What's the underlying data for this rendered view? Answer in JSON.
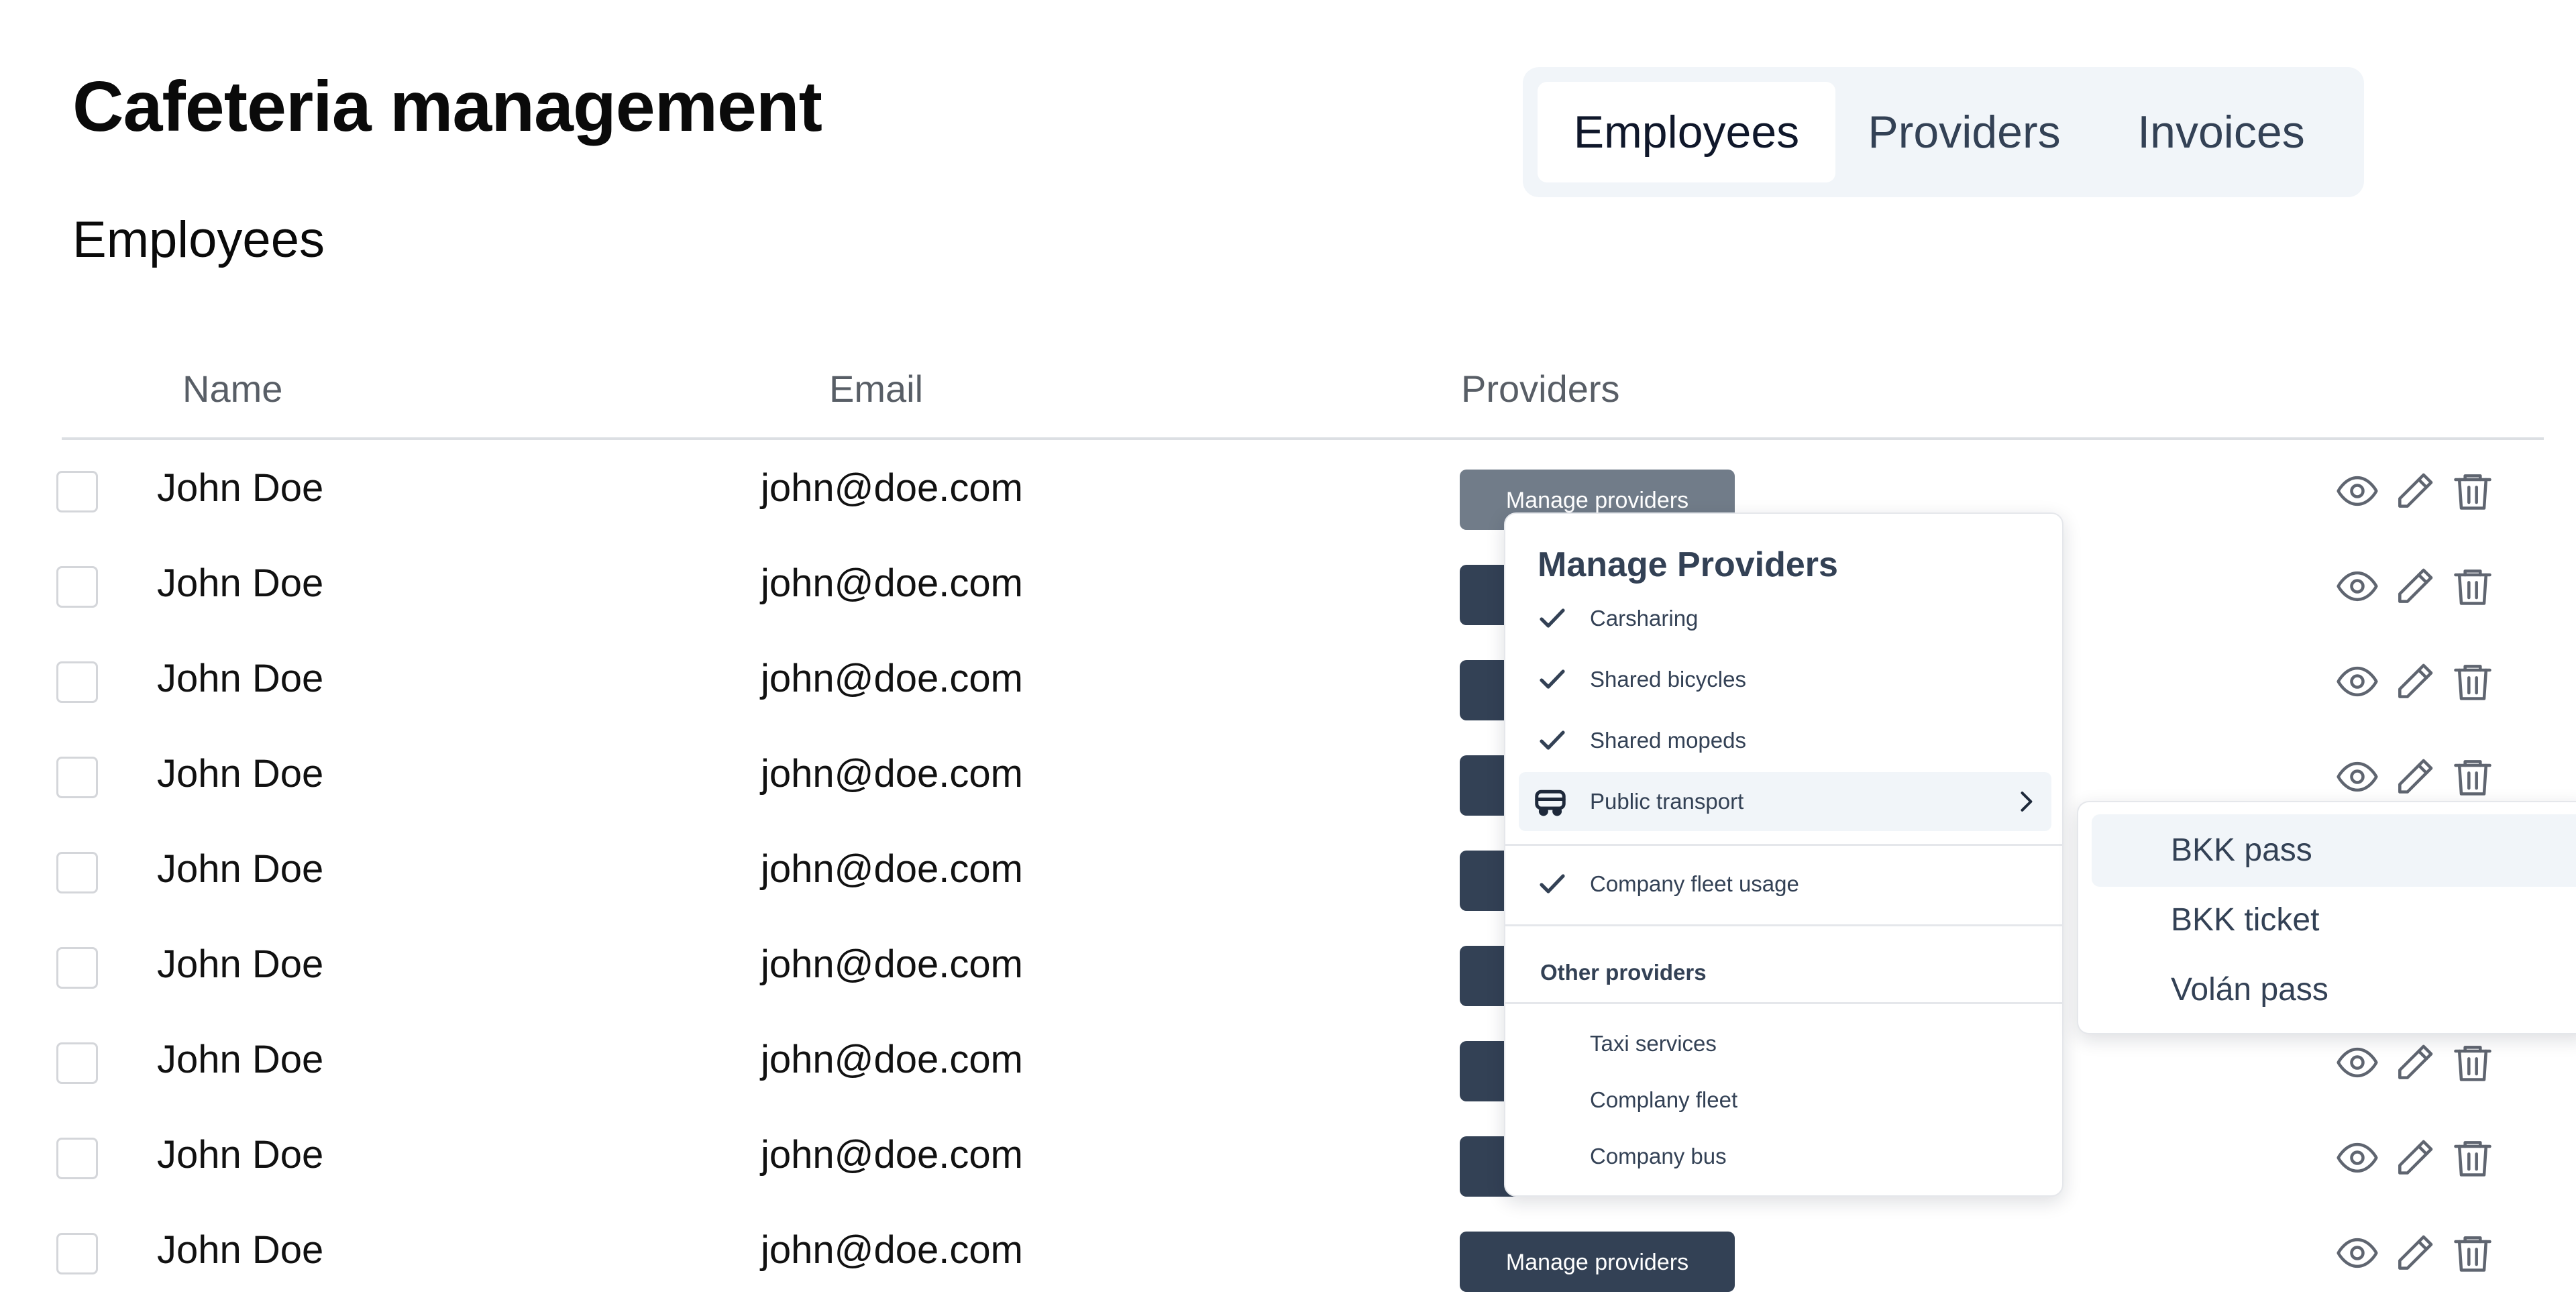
{
  "page": {
    "title": "Cafeteria management",
    "subtitle": "Employees"
  },
  "tabs": [
    {
      "label": "Employees",
      "active": true
    },
    {
      "label": "Providers",
      "active": false
    },
    {
      "label": "Invoices",
      "active": false
    }
  ],
  "table": {
    "columns": [
      "Name",
      "Email",
      "Providers"
    ],
    "button_label": "Manage providers",
    "rows": [
      {
        "name": "John Doe",
        "email": "john@doe.com",
        "checked": false
      },
      {
        "name": "John Doe",
        "email": "john@doe.com",
        "checked": false
      },
      {
        "name": "John Doe",
        "email": "john@doe.com",
        "checked": false
      },
      {
        "name": "John Doe",
        "email": "john@doe.com",
        "checked": false
      },
      {
        "name": "John Doe",
        "email": "john@doe.com",
        "checked": false
      },
      {
        "name": "John Doe",
        "email": "john@doe.com",
        "checked": false
      },
      {
        "name": "John Doe",
        "email": "john@doe.com",
        "checked": false
      },
      {
        "name": "John Doe",
        "email": "john@doe.com",
        "checked": false
      },
      {
        "name": "John Doe",
        "email": "john@doe.com",
        "checked": false
      }
    ],
    "row_actions": [
      "eye-icon",
      "pencil-icon",
      "trash-icon"
    ]
  },
  "menu": {
    "title": "Manage Providers",
    "items": [
      {
        "label": "Carsharing",
        "checked": true
      },
      {
        "label": "Shared bicycles",
        "checked": true
      },
      {
        "label": "Shared mopeds",
        "checked": true
      },
      {
        "label": "Public transport",
        "icon": "bus-icon",
        "has_submenu": true,
        "highlighted": true
      },
      {
        "label": "Company fleet usage",
        "checked": true
      }
    ],
    "group_label": "Other providers",
    "other_items": [
      {
        "label": "Taxi services"
      },
      {
        "label": "Complany fleet"
      },
      {
        "label": "Company bus"
      }
    ]
  },
  "submenu": {
    "items": [
      {
        "label": "BKK pass",
        "highlighted": true
      },
      {
        "label": "BKK ticket",
        "highlighted": false
      },
      {
        "label": "Volán pass",
        "highlighted": false
      }
    ]
  },
  "colors": {
    "primary_button": "#334155",
    "open_button": "#717c89",
    "tab_bg": "#f1f5f9",
    "icon": "#5f6570"
  }
}
